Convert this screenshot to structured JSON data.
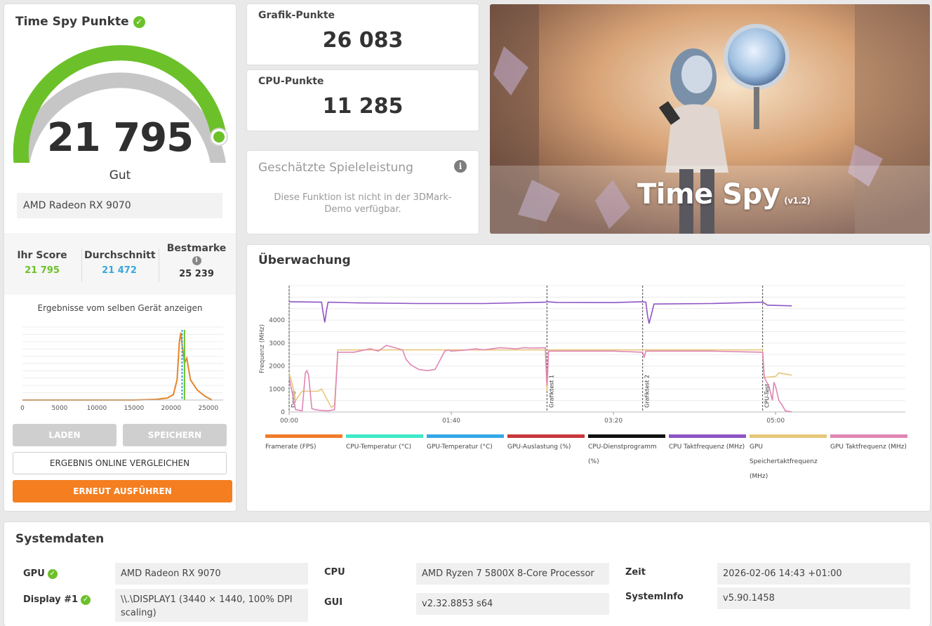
{
  "summary": {
    "title": "Time Spy Punkte",
    "score": "21 795",
    "rating": "Gut",
    "gpu_name": "AMD Radeon RX 9070",
    "gauge_fraction": 0.92
  },
  "stats": {
    "your_label": "Ihr Score",
    "your_value": "21 795",
    "avg_label": "Durchschnitt",
    "avg_value": "21 472",
    "best_label": "Bestmarke",
    "best_value": "25 239"
  },
  "histogram": {
    "caption": "Ergebnisse vom selben Gerät anzeigen",
    "ticks": [
      "0",
      "5000",
      "10000",
      "15000",
      "20000",
      "25000"
    ]
  },
  "buttons": {
    "load": "LADEN",
    "save": "SPEICHERN",
    "compare": "ERGEBNIS ONLINE VERGLEICHEN",
    "rerun": "ERNEUT AUSFÜHREN"
  },
  "graphics": {
    "label": "Grafik-Punkte",
    "score": "26 083"
  },
  "cpu": {
    "label": "CPU-Punkte",
    "score": "11 285"
  },
  "game_perf": {
    "title": "Geschätzte Spieleleistung",
    "message": "Diese Funktion ist nicht in der 3DMark-Demo verfügbar."
  },
  "hero": {
    "title": "Time Spy",
    "version": "(v1.2)"
  },
  "monitoring": {
    "title": "Überwachung",
    "ylabel": "Frequenz (MHz)",
    "legend": [
      {
        "label": "Framerate (FPS)",
        "color": "#f07c28"
      },
      {
        "label": "CPU-Temperatur (°C)",
        "color": "#3ee8c8"
      },
      {
        "label": "GPU-Temperatur (°C)",
        "color": "#35a8e8"
      },
      {
        "label": "GPU-Auslastung (%)",
        "color": "#c8383c"
      },
      {
        "label": "CPU-Dienstprogramm (%)",
        "color": "#111111"
      },
      {
        "label": "CPU Taktfrequenz (MHz)",
        "color": "#8e55c4"
      },
      {
        "label": "GPU Speichertaktfrequenz (MHz)",
        "color": "#e6c87a"
      },
      {
        "label": "GPU Taktfrequenz (MHz)",
        "color": "#e085b4"
      }
    ]
  },
  "chart_data": [
    {
      "type": "area",
      "title": "",
      "xlabel": "",
      "ylabel": "",
      "xlim": [
        0,
        27000
      ],
      "x_ticks": [
        0,
        5000,
        10000,
        15000,
        20000,
        25000
      ],
      "series": [
        {
          "x": [
            0,
            5000,
            10000,
            15000,
            18000,
            19500,
            20300,
            20800,
            21100,
            21300,
            21500,
            21800,
            22100,
            22600,
            23500,
            24500,
            25500
          ],
          "y": [
            0,
            0,
            0,
            0,
            0.01,
            0.03,
            0.08,
            0.3,
            0.85,
            1.0,
            0.8,
            0.55,
            0.62,
            0.3,
            0.15,
            0.06,
            0.0
          ]
        }
      ],
      "markers": [
        {
          "name": "Ihr Score",
          "value": 21795,
          "color": "#6cc12a"
        },
        {
          "name": "Durchschnitt",
          "value": 21472,
          "color": "#3aa7dd"
        }
      ]
    },
    {
      "type": "line",
      "title": "",
      "ylabel": "Frequenz (MHz)",
      "ylim": [
        0,
        5500
      ],
      "y_ticks": [
        0,
        1000,
        2000,
        3000,
        4000
      ],
      "xlim": [
        0,
        380
      ],
      "x_ticks": [
        "00:00",
        "01:40",
        "03:20",
        "05:00"
      ],
      "x_tick_values": [
        0,
        100,
        200,
        300
      ],
      "segments": [
        {
          "label": "Demo",
          "x": 0
        },
        {
          "label": "Grafiktest 1",
          "x": 159
        },
        {
          "label": "Grafiktest 2",
          "x": 218
        },
        {
          "label": "CPU-Test",
          "x": 292
        }
      ],
      "series": [
        {
          "name": "CPU Taktfrequenz (MHz)",
          "x": [
            0,
            20,
            21,
            22,
            23,
            24,
            40,
            80,
            120,
            158,
            159,
            165,
            200,
            218,
            220,
            221,
            222,
            225,
            260,
            292,
            295,
            310
          ],
          "y": [
            4800,
            4780,
            4300,
            3900,
            4400,
            4780,
            4750,
            4720,
            4720,
            4780,
            4800,
            4770,
            4760,
            4800,
            4780,
            4200,
            3850,
            4700,
            4720,
            4780,
            4650,
            4620
          ]
        },
        {
          "name": "GPU Speichertaktfrequenz (MHz)",
          "x": [
            0,
            2,
            4,
            8,
            12,
            18,
            20,
            26,
            28,
            30,
            158,
            159,
            160,
            218,
            219,
            292,
            293,
            300,
            302,
            310
          ],
          "y": [
            1700,
            1200,
            500,
            900,
            900,
            900,
            1000,
            200,
            300,
            2700,
            2700,
            900,
            2700,
            2700,
            2700,
            2700,
            1500,
            1550,
            1700,
            1600
          ]
        },
        {
          "name": "GPU Taktfrequenz (MHz)",
          "x": [
            0,
            4,
            8,
            10,
            11,
            12,
            14,
            16,
            18,
            24,
            28,
            30,
            40,
            50,
            55,
            60,
            70,
            72,
            75,
            80,
            85,
            90,
            96,
            98,
            100,
            110,
            115,
            120,
            130,
            140,
            145,
            150,
            158,
            159,
            160,
            200,
            218,
            219,
            220,
            260,
            292,
            293,
            296,
            298,
            299,
            300,
            302,
            304,
            306,
            310
          ],
          "y": [
            1500,
            100,
            50,
            1700,
            1800,
            1600,
            150,
            100,
            80,
            50,
            100,
            2600,
            2600,
            2750,
            2650,
            2900,
            2700,
            2300,
            2050,
            1850,
            1800,
            1850,
            2650,
            2700,
            2650,
            2700,
            2750,
            2700,
            2800,
            2750,
            2800,
            2780,
            2800,
            1150,
            2650,
            2650,
            2600,
            2400,
            2650,
            2650,
            2600,
            1500,
            1100,
            500,
            1300,
            1100,
            500,
            300,
            50,
            0
          ]
        }
      ]
    }
  ],
  "system": {
    "title": "Systemdaten",
    "gpu_key": "GPU",
    "gpu_val": "AMD Radeon RX 9070",
    "display_key": "Display #1",
    "display_val": "\\\\.\\DISPLAY1 (3440 × 1440, 100% DPI scaling)",
    "cpu_key": "CPU",
    "cpu_val": "AMD Ryzen 7 5800X 8-Core Processor",
    "gui_key": "GUI",
    "gui_val": "v2.32.8853 s64",
    "time_key": "Zeit",
    "time_val": "2026-02-06 14:43 +01:00",
    "sysinfo_key": "SystemInfo",
    "sysinfo_val": "v5.90.1458"
  }
}
